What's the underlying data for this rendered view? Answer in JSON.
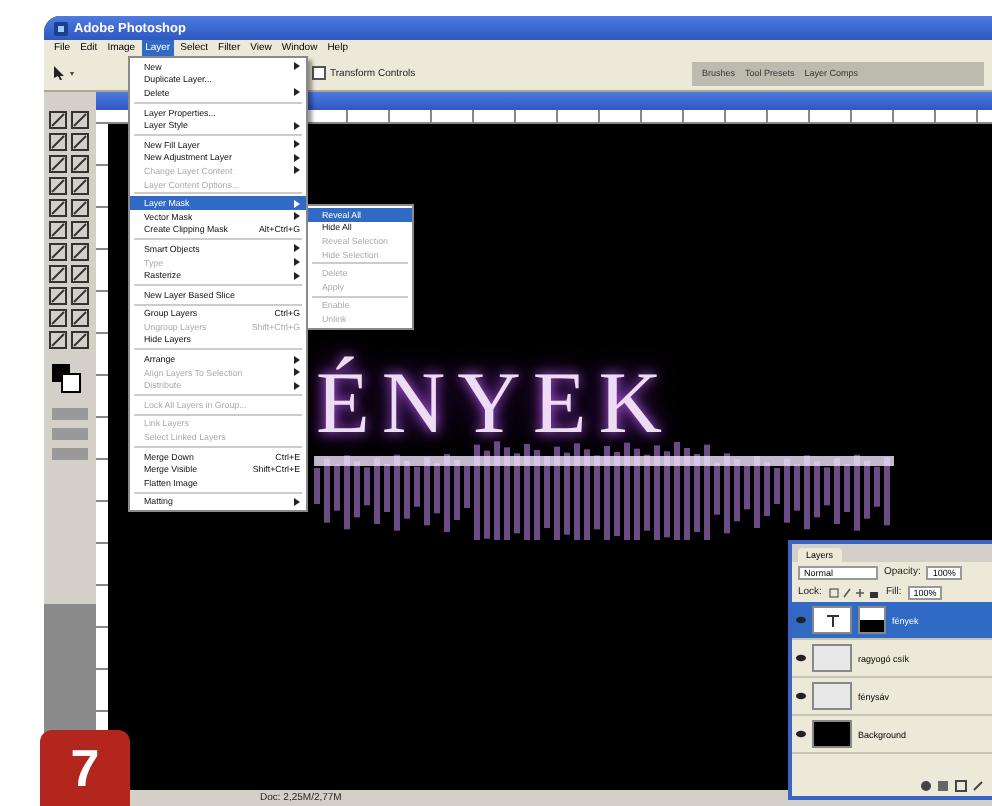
{
  "window": {
    "title": "Adobe Photoshop"
  },
  "menubar": [
    {
      "label": "File",
      "selected": false
    },
    {
      "label": "Edit",
      "selected": false
    },
    {
      "label": "Image",
      "selected": false
    },
    {
      "label": "Layer",
      "selected": true
    },
    {
      "label": "Select",
      "selected": false
    },
    {
      "label": "Filter",
      "selected": false
    },
    {
      "label": "View",
      "selected": false
    },
    {
      "label": "Window",
      "selected": false
    },
    {
      "label": "Help",
      "selected": false
    }
  ],
  "options_bar": {
    "checkbox_label": "Transform Controls",
    "checked": false,
    "palette_tabs": [
      "Brushes",
      "Tool Presets",
      "Layer Comps"
    ]
  },
  "layer_menu": [
    {
      "kind": "item",
      "label": "New",
      "submenu": true,
      "disabled": false,
      "selected": false
    },
    {
      "kind": "item",
      "label": "Duplicate Layer...",
      "submenu": false,
      "disabled": false,
      "selected": false
    },
    {
      "kind": "item",
      "label": "Delete",
      "submenu": true,
      "disabled": false,
      "selected": false
    },
    {
      "kind": "separator"
    },
    {
      "kind": "item",
      "label": "Layer Properties...",
      "submenu": false,
      "disabled": false,
      "selected": false
    },
    {
      "kind": "item",
      "label": "Layer Style",
      "submenu": true,
      "disabled": false,
      "selected": false
    },
    {
      "kind": "separator"
    },
    {
      "kind": "item",
      "label": "New Fill Layer",
      "submenu": true,
      "disabled": false,
      "selected": false
    },
    {
      "kind": "item",
      "label": "New Adjustment Layer",
      "submenu": true,
      "disabled": false,
      "selected": false
    },
    {
      "kind": "item",
      "label": "Change Layer Content",
      "submenu": true,
      "disabled": true,
      "selected": false
    },
    {
      "kind": "item",
      "label": "Layer Content Options...",
      "submenu": false,
      "disabled": true,
      "selected": false
    },
    {
      "kind": "separator"
    },
    {
      "kind": "item",
      "label": "Layer Mask",
      "submenu": true,
      "disabled": false,
      "selected": true
    },
    {
      "kind": "item",
      "label": "Vector Mask",
      "submenu": true,
      "disabled": false,
      "selected": false
    },
    {
      "kind": "item",
      "label": "Create Clipping Mask",
      "shortcut": "Alt+Ctrl+G",
      "submenu": false,
      "disabled": false,
      "selected": false
    },
    {
      "kind": "separator"
    },
    {
      "kind": "item",
      "label": "Smart Objects",
      "submenu": true,
      "disabled": false,
      "selected": false
    },
    {
      "kind": "item",
      "label": "Type",
      "submenu": true,
      "disabled": true,
      "selected": false
    },
    {
      "kind": "item",
      "label": "Rasterize",
      "submenu": true,
      "disabled": false,
      "selected": false
    },
    {
      "kind": "separator"
    },
    {
      "kind": "item",
      "label": "New Layer Based Slice",
      "submenu": false,
      "disabled": false,
      "selected": false
    },
    {
      "kind": "separator"
    },
    {
      "kind": "item",
      "label": "Group Layers",
      "shortcut": "Ctrl+G",
      "submenu": false,
      "disabled": false,
      "selected": false
    },
    {
      "kind": "item",
      "label": "Ungroup Layers",
      "shortcut": "Shift+Ctrl+G",
      "submenu": false,
      "disabled": true,
      "selected": false
    },
    {
      "kind": "item",
      "label": "Hide Layers",
      "submenu": false,
      "disabled": false,
      "selected": false
    },
    {
      "kind": "separator"
    },
    {
      "kind": "item",
      "label": "Arrange",
      "submenu": true,
      "disabled": false,
      "selected": false
    },
    {
      "kind": "item",
      "label": "Align Layers To Selection",
      "submenu": true,
      "disabled": true,
      "selected": false
    },
    {
      "kind": "item",
      "label": "Distribute",
      "submenu": true,
      "disabled": true,
      "selected": false
    },
    {
      "kind": "separator"
    },
    {
      "kind": "item",
      "label": "Lock All Layers in Group...",
      "submenu": false,
      "disabled": true,
      "selected": false
    },
    {
      "kind": "separator"
    },
    {
      "kind": "item",
      "label": "Link Layers",
      "submenu": false,
      "disabled": true,
      "selected": false
    },
    {
      "kind": "item",
      "label": "Select Linked Layers",
      "submenu": false,
      "disabled": true,
      "selected": false
    },
    {
      "kind": "separator"
    },
    {
      "kind": "item",
      "label": "Merge Down",
      "shortcut": "Ctrl+E",
      "submenu": false,
      "disabled": false,
      "selected": false
    },
    {
      "kind": "item",
      "label": "Merge Visible",
      "shortcut": "Shift+Ctrl+E",
      "submenu": false,
      "disabled": false,
      "selected": false
    },
    {
      "kind": "item",
      "label": "Flatten Image",
      "submenu": false,
      "disabled": false,
      "selected": false
    },
    {
      "kind": "separator"
    },
    {
      "kind": "item",
      "label": "Matting",
      "submenu": true,
      "disabled": false,
      "selected": false
    }
  ],
  "mask_submenu": [
    {
      "kind": "item",
      "label": "Reveal All",
      "disabled": false,
      "selected": true
    },
    {
      "kind": "item",
      "label": "Hide All",
      "disabled": false,
      "selected": false
    },
    {
      "kind": "item",
      "label": "Reveal Selection",
      "disabled": true,
      "selected": false
    },
    {
      "kind": "item",
      "label": "Hide Selection",
      "disabled": true,
      "selected": false
    },
    {
      "kind": "separator"
    },
    {
      "kind": "item",
      "label": "Delete",
      "disabled": true,
      "selected": false
    },
    {
      "kind": "item",
      "label": "Apply",
      "disabled": true,
      "selected": false
    },
    {
      "kind": "separator"
    },
    {
      "kind": "item",
      "label": "Enable",
      "disabled": true,
      "selected": false
    },
    {
      "kind": "item",
      "label": "Unlink",
      "disabled": true,
      "selected": false
    }
  ],
  "canvas": {
    "text": "ÉNYEK"
  },
  "status_bar": {
    "doc": "Doc: 2,25M/2,77M"
  },
  "layers_panel": {
    "tab": "Layers",
    "blend_mode": "Normal",
    "opacity_label": "Opacity:",
    "opacity": "100%",
    "lock_label": "Lock:",
    "fill_label": "Fill:",
    "fill": "100%",
    "layers": [
      {
        "kind": "text",
        "name": "fények",
        "visible": true,
        "selected": true,
        "mask": true
      },
      {
        "kind": "blank",
        "name": "ragyogó csík",
        "visible": true,
        "selected": false,
        "mask": false
      },
      {
        "kind": "blank",
        "name": "fénysáv",
        "visible": true,
        "selected": false,
        "mask": false
      },
      {
        "kind": "fill",
        "name": "Background",
        "visible": true,
        "selected": false,
        "mask": false
      }
    ]
  },
  "step_badge": "7"
}
